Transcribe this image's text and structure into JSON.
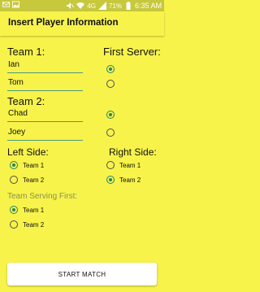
{
  "status_bar": {
    "signal_text": "4G",
    "battery": "71%",
    "time": "6:35 AM"
  },
  "app_bar": {
    "title": "Insert Player Information"
  },
  "team1": {
    "label": "Team 1:",
    "players": [
      "Ian",
      "Tom"
    ]
  },
  "first_server": {
    "label": "First Server:",
    "selected_index": 0
  },
  "team2": {
    "label": "Team 2:",
    "players": [
      "Chad",
      "Joey"
    ]
  },
  "team2_server": {
    "selected_index": 0
  },
  "left_side": {
    "label": "Left Side:",
    "options": [
      "Team 1",
      "Team 2"
    ],
    "selected": "Team 1"
  },
  "right_side": {
    "label": "Right Side:",
    "options": [
      "Team 1",
      "Team 2"
    ],
    "selected": "Team 2"
  },
  "team_serving_first": {
    "label": "Team Serving First:",
    "options": [
      "Team 1",
      "Team 2"
    ],
    "selected": "Team 1"
  },
  "start_button": {
    "label": "START MATCH"
  },
  "colors": {
    "background": "#f7f34a",
    "status_bar": "#c7c83c",
    "accent": "#23866a"
  }
}
